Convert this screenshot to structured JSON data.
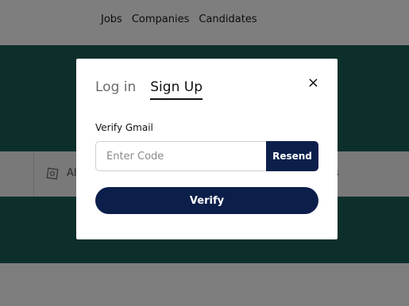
{
  "nav": {
    "links": [
      "Jobs",
      "Companies",
      "Candidates"
    ]
  },
  "filter_bar": {
    "left_text": "Al",
    "right_text": "es"
  },
  "modal": {
    "tabs": [
      {
        "label": "Log in",
        "active": false
      },
      {
        "label": "Sign Up",
        "active": true
      }
    ],
    "close_glyph": "×",
    "field_label": "Verify Gmail",
    "code_placeholder": "Enter Code",
    "code_value": "",
    "resend_label": "Resend",
    "verify_label": "Verify"
  },
  "colors": {
    "primary_button": "#0c1f4b",
    "hero_teal": "#1b5e57"
  }
}
